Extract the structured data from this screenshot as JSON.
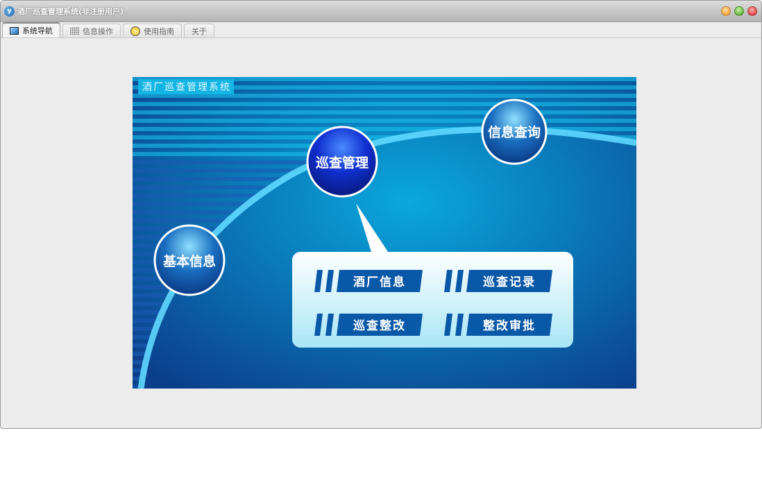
{
  "window": {
    "title": "酒厂巡查管理系统(非注册用户)",
    "controls": [
      "minimize",
      "maximize",
      "close"
    ]
  },
  "tabs": [
    {
      "label": "系统导航",
      "icon": "monitor-icon",
      "active": true
    },
    {
      "label": "信息操作",
      "icon": "grid-icon"
    },
    {
      "label": "使用指南",
      "icon": "help-icon"
    },
    {
      "label": "关于"
    }
  ],
  "banner": {
    "title": "酒厂巡查管理系统",
    "circles": {
      "basic": "基本信息",
      "patrol": "巡查管理",
      "query": "信息查询"
    },
    "menu": [
      "酒厂信息",
      "巡查记录",
      "巡查整改",
      "整改审批"
    ]
  }
}
